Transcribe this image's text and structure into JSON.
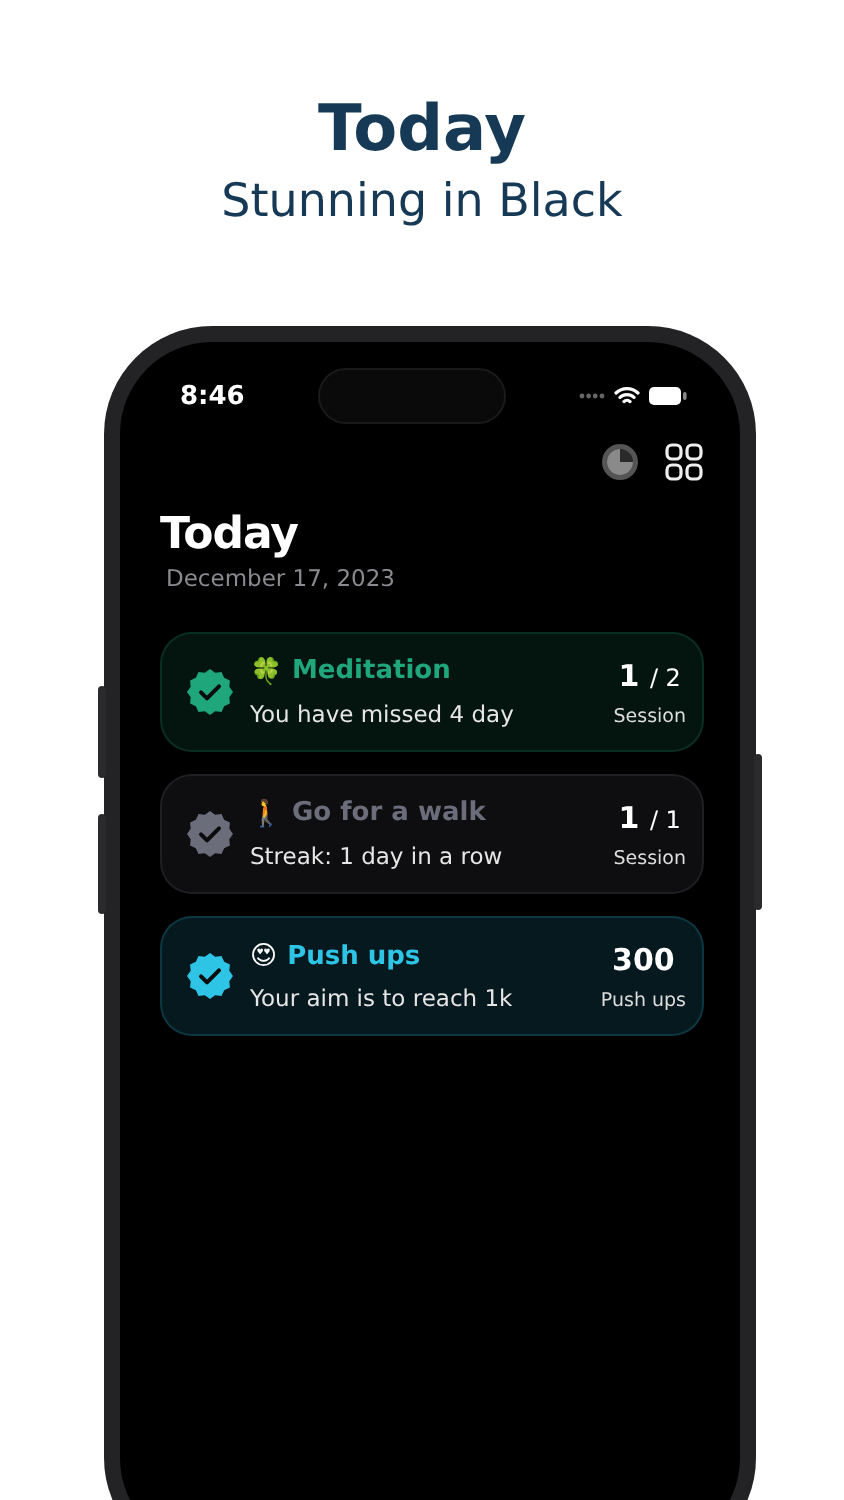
{
  "header": {
    "title": "Today",
    "subtitle": "Stunning in Black"
  },
  "status_bar": {
    "time": "8:46"
  },
  "screen": {
    "title": "Today",
    "date": "December 17, 2023"
  },
  "habits": [
    {
      "emoji": "🍀",
      "name": "Meditation",
      "detail": "You have missed 4 day",
      "count": "1",
      "total": "/ 2",
      "unit": "Session",
      "color": "#1fa67a"
    },
    {
      "emoji": "🚶",
      "name": "Go for a walk",
      "detail": "Streak: 1 day in a row",
      "count": "1",
      "total": "/ 1",
      "unit": "Session",
      "color": "#6b6d7a"
    },
    {
      "emoji": "😍",
      "name": "Push ups",
      "detail": "Your aim is to reach 1k",
      "count": "300",
      "unit": "Push ups",
      "color": "#2ec4e6"
    }
  ]
}
